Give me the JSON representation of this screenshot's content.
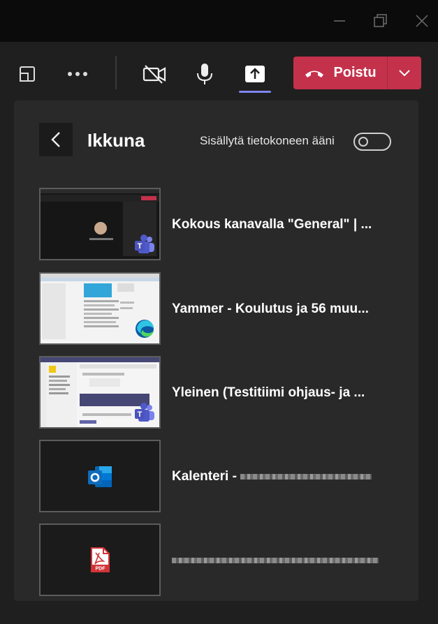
{
  "window_controls": {
    "minimize_icon": "minimize-icon",
    "restore_icon": "restore-icon",
    "close_icon": "close-icon"
  },
  "toolbar": {
    "leave_label": "Poistu",
    "colors": {
      "leave": "#c4314b",
      "share_active": "#7f85f5"
    }
  },
  "panel": {
    "title": "Ikkuna",
    "include_audio_label": "Sisällytä tietokoneen ääni",
    "include_audio_on": false
  },
  "windows": [
    {
      "title": "Kokous kanavalla \"General\" | ...",
      "app_icon": "teams-icon"
    },
    {
      "title": "Yammer - Koulutus ja 56 muu...",
      "app_icon": "edge-icon"
    },
    {
      "title": "Yleinen (Testitiimi ohjaus- ja ...",
      "app_icon": "teams-icon"
    },
    {
      "title": "Kalenteri - ",
      "app_icon": "outlook-icon"
    },
    {
      "title": "",
      "app_icon": "pdf-icon"
    }
  ]
}
